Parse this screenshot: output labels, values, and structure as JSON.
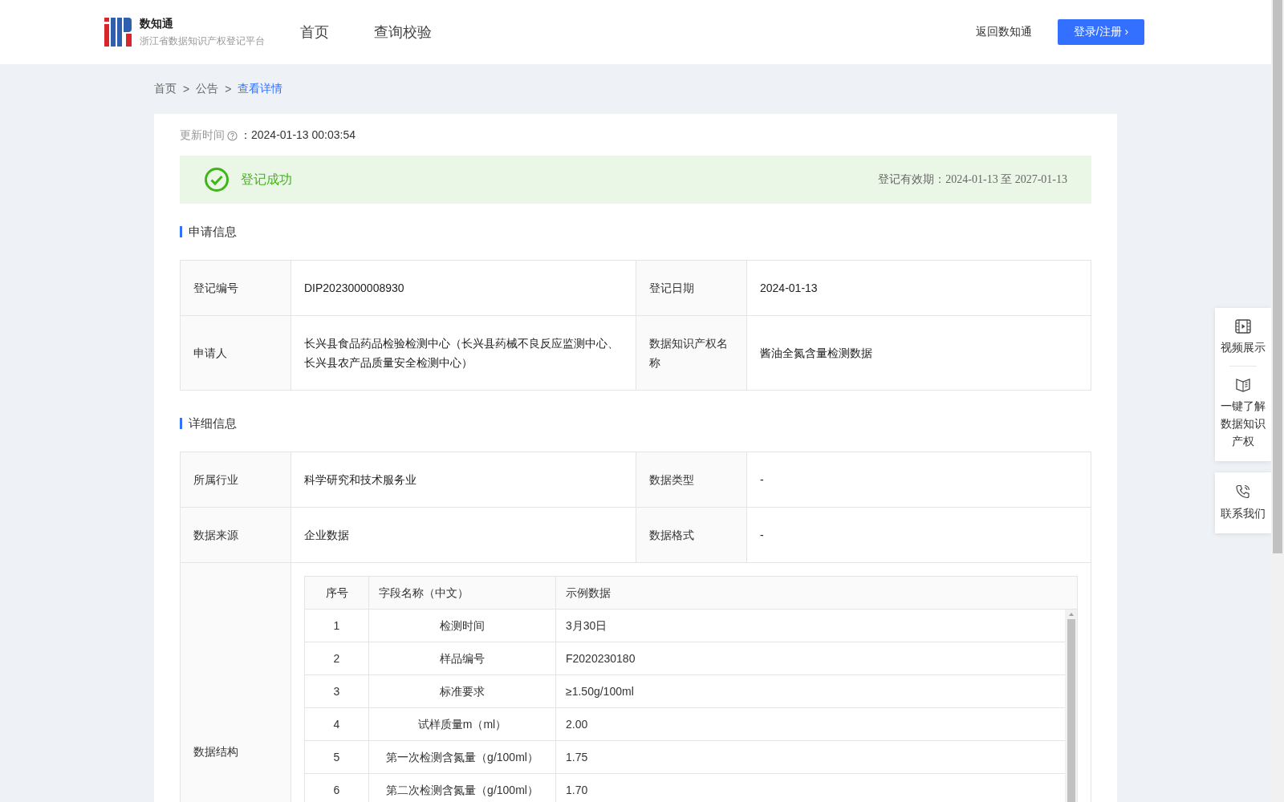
{
  "header": {
    "logo": {
      "name": "数知通",
      "subtitle": "浙江省数据知识产权登记平台"
    },
    "nav": [
      {
        "label": "首页",
        "selected": false
      },
      {
        "label": "查询校验",
        "selected": false
      }
    ],
    "return_link": "返回数知通",
    "login_button": "登录/注册 ›"
  },
  "breadcrumb": [
    {
      "label": "首页",
      "selected": false
    },
    {
      "label": "公告",
      "selected": false
    },
    {
      "label": "查看详情",
      "selected": true
    }
  ],
  "breadcrumb_separator": ">",
  "update_time": {
    "label": "更新时间",
    "value": "：2024-01-13 00:03:54"
  },
  "status": {
    "text": "登记成功",
    "validity": "登记有效期：2024-01-13 至 2027-01-13"
  },
  "application": {
    "title": "申请信息",
    "rows": [
      [
        {
          "label": "登记编号",
          "value": "DIP2023000008930"
        },
        {
          "label": "登记日期",
          "value": "2024-01-13"
        }
      ],
      [
        {
          "label": "申请人",
          "value": "长兴县食品药品检验检测中心（长兴县药械不良反应监测中心、长兴县农产品质量安全检测中心）"
        },
        {
          "label": "数据知识产权名称",
          "value": "酱油全氮含量检测数据"
        }
      ]
    ]
  },
  "details": {
    "title": "详细信息",
    "rows": [
      [
        {
          "label": "所属行业",
          "value": "科学研究和技术服务业"
        },
        {
          "label": "数据类型",
          "value": "-"
        }
      ],
      [
        {
          "label": "数据来源",
          "value": "企业数据"
        },
        {
          "label": "数据格式",
          "value": "-"
        }
      ]
    ],
    "structure": {
      "label": "数据结构",
      "columns": [
        "序号",
        "字段名称（中文）",
        "示例数据"
      ],
      "rows": [
        [
          "1",
          "检测时间",
          "3月30日"
        ],
        [
          "2",
          "样品编号",
          "F2020230180"
        ],
        [
          "3",
          "标准要求",
          "≥1.50g/100ml"
        ],
        [
          "4",
          "试样质量m（ml）",
          "2.00"
        ],
        [
          "5",
          "第一次检测含氮量（g/100ml）",
          "1.75"
        ],
        [
          "6",
          "第二次检测含氮量（g/100ml）",
          "1.70"
        ]
      ]
    }
  },
  "side_panel": [
    {
      "items": [
        {
          "kind": "video",
          "label": "视频展示"
        },
        {
          "kind": "book",
          "label": "一键了解数据知识产权"
        }
      ]
    },
    {
      "items": [
        {
          "kind": "phone",
          "label": "联系我们"
        }
      ]
    }
  ]
}
